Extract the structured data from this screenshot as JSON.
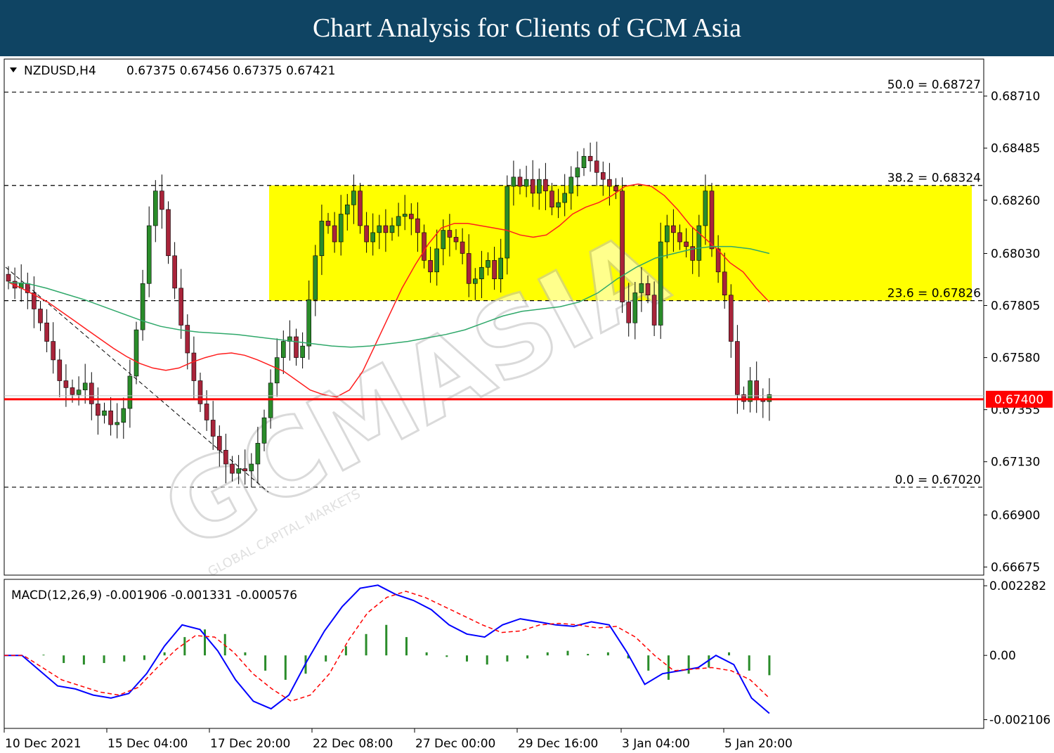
{
  "banner": {
    "title": "Chart Analysis for Clients of GCM Asia"
  },
  "watermark": {
    "brand": "GCMASIA",
    "tagline": "GLOBAL CAPITAL MARKETS"
  },
  "chart_data": [
    {
      "type": "candlestick",
      "title": "NZDUSD,H4",
      "ohlc_text": "0.67375 0.67456 0.67375 0.67421",
      "ylim": [
        0.6664,
        0.6887
      ],
      "yticks": [
        "0.68710",
        "0.68485",
        "0.68260",
        "0.68030",
        "0.67805",
        "0.67580",
        "0.67355",
        "0.67130",
        "0.66900",
        "0.66675"
      ],
      "xticks": [
        "10 Dec 2021",
        "15 Dec 04:00",
        "17 Dec 20:00",
        "22 Dec 08:00",
        "27 Dec 00:00",
        "29 Dec 16:00",
        "3 Jan 04:00",
        "5 Jan 20:00"
      ],
      "price_marker": {
        "value": 0.674,
        "label": "0.67400",
        "color": "#ff0000"
      },
      "fibonacci": [
        {
          "label": "50.0 = 0.68727",
          "value": 0.68727
        },
        {
          "label": "38.2 = 0.68324",
          "value": 0.68324
        },
        {
          "label": "23.6 = 0.67826",
          "value": 0.67826
        },
        {
          "label": "0.0 = 0.67020",
          "value": 0.6702
        }
      ],
      "zone": {
        "from": 0.67826,
        "to": 0.68324,
        "color": "#ffff00"
      },
      "colors": {
        "bull": "#2a8c2a",
        "bear": "#a8243a",
        "ma_fast": "#ff1d1d",
        "ma_slow": "#2fa86a"
      },
      "closes": [
        0.6791,
        0.6788,
        0.679,
        0.6786,
        0.6779,
        0.6773,
        0.6765,
        0.6757,
        0.6748,
        0.6745,
        0.6742,
        0.6744,
        0.6747,
        0.6738,
        0.6733,
        0.6735,
        0.6729,
        0.673,
        0.6736,
        0.675,
        0.677,
        0.679,
        0.6815,
        0.683,
        0.6822,
        0.6802,
        0.6788,
        0.6772,
        0.676,
        0.6748,
        0.6738,
        0.6731,
        0.6724,
        0.6718,
        0.6712,
        0.6708,
        0.671,
        0.6709,
        0.6712,
        0.6721,
        0.6732,
        0.6747,
        0.6758,
        0.6765,
        0.6767,
        0.6758,
        0.6763,
        0.6783,
        0.6802,
        0.6817,
        0.6815,
        0.6808,
        0.682,
        0.6824,
        0.683,
        0.6815,
        0.6808,
        0.6812,
        0.6815,
        0.6812,
        0.6815,
        0.6819,
        0.682,
        0.6818,
        0.6812,
        0.68,
        0.6795,
        0.6805,
        0.6813,
        0.681,
        0.6808,
        0.6803,
        0.679,
        0.6792,
        0.6797,
        0.68,
        0.6792,
        0.6801,
        0.6832,
        0.6836,
        0.6832,
        0.6835,
        0.6829,
        0.6835,
        0.683,
        0.6823,
        0.6825,
        0.6829,
        0.6836,
        0.684,
        0.6845,
        0.6843,
        0.6838,
        0.6835,
        0.6832,
        0.683,
        0.6782,
        0.6773,
        0.6786,
        0.679,
        0.6785,
        0.6772,
        0.6808,
        0.6815,
        0.6812,
        0.6808,
        0.6806,
        0.68,
        0.6815,
        0.683,
        0.6805,
        0.6795,
        0.6785,
        0.6765,
        0.6742,
        0.6739,
        0.6748,
        0.674,
        0.6739,
        0.6742
      ],
      "ma_fast": [
        0.67905,
        0.6788,
        0.6785,
        0.6782,
        0.6778,
        0.6774,
        0.677,
        0.6766,
        0.6762,
        0.67585,
        0.67555,
        0.67535,
        0.67525,
        0.67535,
        0.6756,
        0.6758,
        0.67595,
        0.676,
        0.6759,
        0.6757,
        0.67545,
        0.6752,
        0.6748,
        0.6744,
        0.6742,
        0.6741,
        0.6744,
        0.6752,
        0.6764,
        0.6776,
        0.6788,
        0.6798,
        0.6807,
        0.6814,
        0.6816,
        0.6816,
        0.6815,
        0.6814,
        0.6813,
        0.6811,
        0.681,
        0.6811,
        0.6815,
        0.682,
        0.6823,
        0.6825,
        0.6828,
        0.6832,
        0.6833,
        0.6832,
        0.6828,
        0.6822,
        0.6815,
        0.681,
        0.6805,
        0.6799,
        0.6795,
        0.6788,
        0.6782
      ],
      "ma_slow": [
        0.67905,
        0.679,
        0.6788,
        0.67855,
        0.6783,
        0.678,
        0.6777,
        0.6774,
        0.67715,
        0.677,
        0.6769,
        0.67685,
        0.6768,
        0.6767,
        0.6766,
        0.6765,
        0.6764,
        0.6763,
        0.67625,
        0.6763,
        0.6764,
        0.6765,
        0.67665,
        0.6768,
        0.677,
        0.6773,
        0.6776,
        0.6778,
        0.6779,
        0.678,
        0.6782,
        0.6786,
        0.6792,
        0.6797,
        0.6801,
        0.6803,
        0.6805,
        0.6806,
        0.6806,
        0.6805,
        0.6803
      ]
    },
    {
      "type": "macd",
      "title": "MACD(12,26,9) -0.001906 -0.001331 -0.000576",
      "ylim": [
        -0.0023,
        0.0024
      ],
      "yticks": [
        "0.002282",
        "0.00",
        "-0.002106"
      ],
      "colors": {
        "macd": "#0000ff",
        "signal": "#ff0000",
        "hist": "#2a8c2a"
      },
      "macd": [
        0.0,
        0.0,
        -0.0005,
        -0.001,
        -0.0011,
        -0.0013,
        -0.0014,
        -0.00125,
        -0.0006,
        0.0003,
        0.001,
        0.00085,
        0.00015,
        -0.0008,
        -0.0015,
        -0.00175,
        -0.0013,
        -0.0002,
        0.0008,
        0.0016,
        0.0022,
        0.0023,
        0.002,
        0.0018,
        0.0015,
        0.001,
        0.0007,
        0.0006,
        0.001,
        0.0012,
        0.0011,
        0.001,
        0.00095,
        0.0011,
        0.001,
        0.0001,
        -0.00095,
        -0.0006,
        -0.0005,
        -0.0004,
        0.0,
        -0.0003,
        -0.0014,
        -0.0019
      ],
      "signal": [
        0.0,
        0.0,
        -0.0004,
        -0.0008,
        -0.001,
        -0.0012,
        -0.0013,
        -0.00105,
        -0.0004,
        0.0002,
        0.00065,
        0.0006,
        0.0001,
        -0.0006,
        -0.0011,
        -0.0015,
        -0.0013,
        -0.0006,
        0.0005,
        0.0014,
        0.0019,
        0.0021,
        0.0019,
        0.0016,
        0.0013,
        0.001,
        0.00075,
        0.0008,
        0.001,
        0.00105,
        0.001,
        0.0009,
        0.00095,
        0.0006,
        0.0,
        -0.0005,
        -0.00045,
        -0.0004,
        -0.0005,
        -0.0008,
        -0.0014
      ],
      "hist": [
        0.0,
        -0.00025,
        -0.0003,
        -0.00025,
        -0.0002,
        -0.00015,
        0.0001,
        0.0006,
        0.00085,
        0.0007,
        0.0001,
        -0.0005,
        -0.0008,
        -0.0006,
        -0.0002,
        0.0003,
        0.0007,
        0.001,
        0.0006,
        0.0001,
        -5e-05,
        -0.0002,
        -0.0003,
        -0.0002,
        -0.0001,
        0.0001,
        0.00015,
        5e-05,
        0.0001,
        -0.0001,
        -0.0005,
        -0.0008,
        -0.0006,
        -0.0004,
        0.0001,
        -0.0005,
        -0.00065
      ]
    }
  ]
}
